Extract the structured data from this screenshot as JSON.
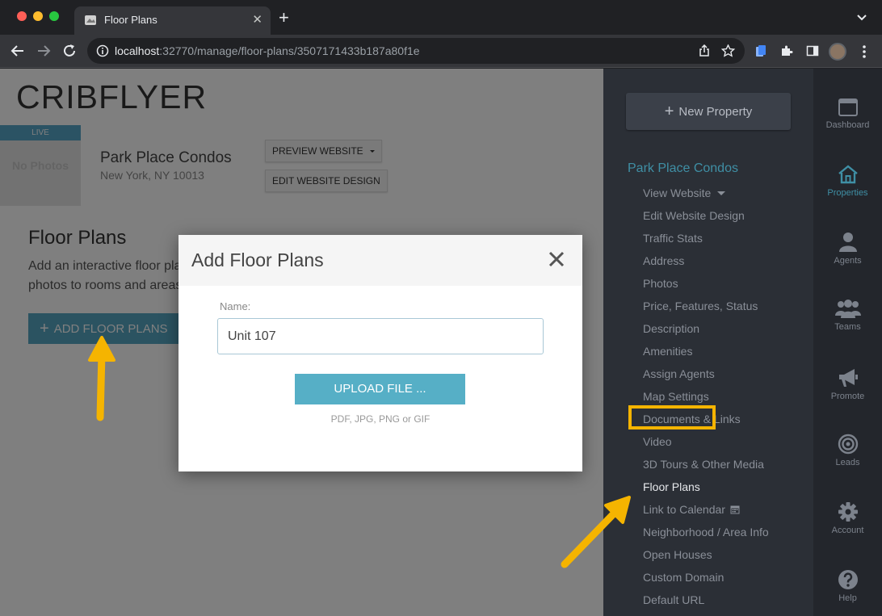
{
  "browser": {
    "tab_title": "Floor Plans",
    "tab_close": "✕",
    "new_tab": "+",
    "url_host": "localhost",
    "url_path": ":32770/manage/floor-plans/3507171433b187a80f1e"
  },
  "page": {
    "logo": "CRIBFLYER",
    "property": {
      "live_badge": "LIVE",
      "no_photos": "No Photos",
      "name": "Park Place Condos",
      "address": "New York, NY 10013"
    },
    "preview_button": "PREVIEW WEBSITE",
    "edit_design_button": "EDIT WEBSITE DESIGN",
    "heading": "Floor Plans",
    "description": "Add an interactive floor pla photos to rooms and areas.",
    "add_button_plus": "+",
    "add_button": "ADD FLOOR PLANS"
  },
  "modal": {
    "title": "Add Floor Plans",
    "name_label": "Name:",
    "name_value": "Unit 107",
    "upload_button": "UPLOAD FILE ...",
    "file_hint": "PDF, JPG, PNG or GIF"
  },
  "sidebar": {
    "new_property_plus": "+",
    "new_property": "New Property",
    "property_name": "Park Place Condos",
    "items": [
      "View Website",
      "Edit Website Design",
      "Traffic Stats",
      "Address",
      "Photos",
      "Price, Features, Status",
      "Description",
      "Amenities",
      "Assign Agents",
      "Map Settings",
      "Documents & Links",
      "Video",
      "3D Tours & Other Media",
      "Floor Plans",
      "Link to Calendar",
      "Neighborhood / Area Info",
      "Open Houses",
      "Custom Domain",
      "Default URL"
    ]
  },
  "iconbar": {
    "dashboard": "Dashboard",
    "properties": "Properties",
    "agents": "Agents",
    "teams": "Teams",
    "promote": "Promote",
    "leads": "Leads",
    "account": "Account",
    "help": "Help"
  },
  "colors": {
    "accent": "#56a6c2",
    "sidebar_bg": "#2b2f36",
    "highlight": "#f5b400"
  }
}
